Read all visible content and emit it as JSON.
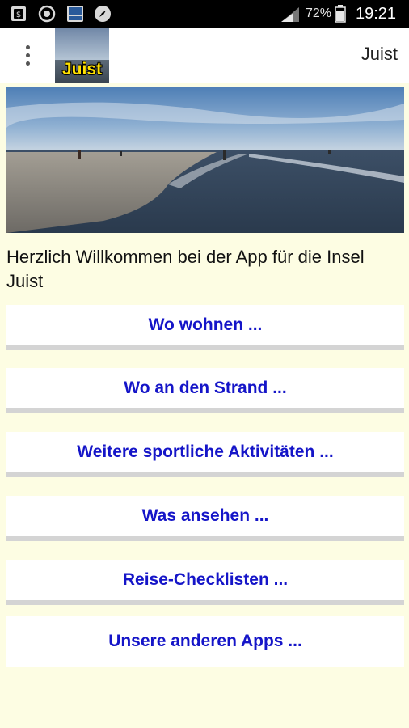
{
  "status_bar": {
    "battery_percent": "72%",
    "time": "19:21"
  },
  "action_bar": {
    "logo_text": "Juist",
    "title": "Juist"
  },
  "welcome_text": "Herzlich Willkommen bei der App für die Insel Juist",
  "menu": [
    {
      "label": "Wo wohnen ..."
    },
    {
      "label": "Wo an den Strand ..."
    },
    {
      "label": "Weitere sportliche Aktivitäten ..."
    },
    {
      "label": "Was ansehen ..."
    },
    {
      "label": "Reise-Checklisten ..."
    },
    {
      "label": "Unsere anderen Apps ..."
    }
  ],
  "colors": {
    "background": "#fdfde3",
    "link": "#1515c8",
    "status_bar": "#000000"
  },
  "icons": [
    "sim-icon",
    "sync-icon",
    "newspaper-app-icon",
    "compass-icon",
    "signal-icon",
    "battery-icon",
    "overflow-menu-icon"
  ]
}
